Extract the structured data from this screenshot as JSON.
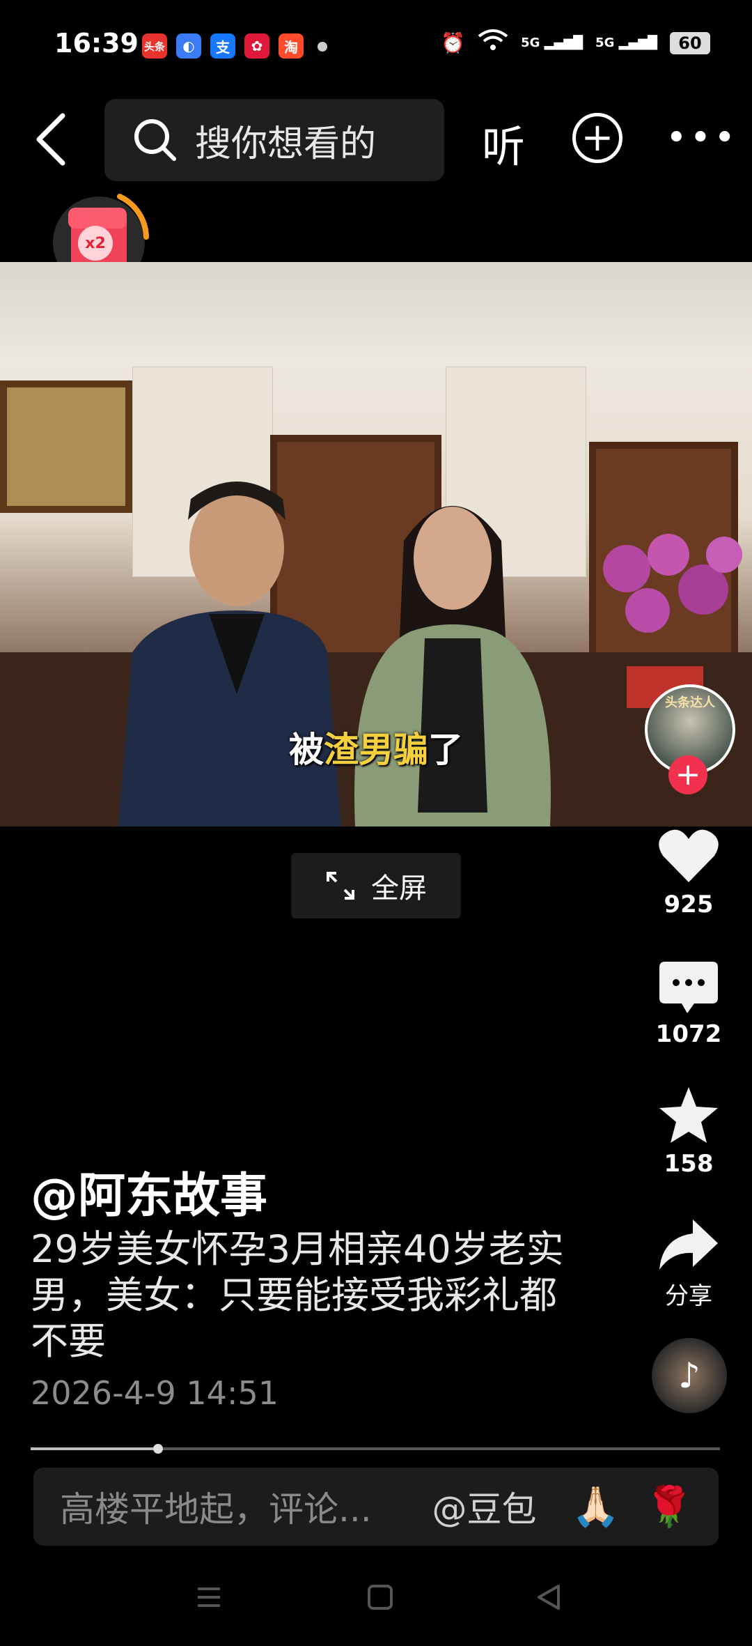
{
  "status_bar": {
    "time": "16:39",
    "apps": [
      {
        "label": "头条",
        "color": "#e8322d"
      },
      {
        "label": "",
        "color": "#3a7bf7"
      },
      {
        "label": "支",
        "color": "#1677ff"
      },
      {
        "label": "",
        "color": "#e0193a"
      },
      {
        "label": "淘",
        "color": "#ff4b2b"
      }
    ],
    "signal": "5G",
    "battery": "60"
  },
  "top_nav": {
    "search_placeholder": "搜你想看的",
    "listen_label": "听"
  },
  "red_packet": {
    "badge": "x2"
  },
  "video": {
    "subtitle_pre": "被",
    "subtitle_highlight": "渣男骗",
    "subtitle_post": "了",
    "fullscreen_label": "全屏",
    "channel_badge": "头条达人"
  },
  "actions": {
    "like_count": "925",
    "comment_count": "1072",
    "favorite_count": "158",
    "share_label": "分享"
  },
  "caption": {
    "author": "@阿东故事",
    "title": "29岁美女怀孕3月相亲40岁老实男，美女：只要能接受我彩礼都不要",
    "date": "2026-4-9 14:51"
  },
  "progress": {
    "fraction": 0.185
  },
  "comment_bar": {
    "placeholder": "高楼平地起，评论...",
    "mention": "@豆包",
    "emoji_1": "🙏🏻",
    "emoji_2": "🌹"
  },
  "colors": {
    "accent_red": "#f1314d",
    "subtitle_highlight": "#f4d03f"
  }
}
